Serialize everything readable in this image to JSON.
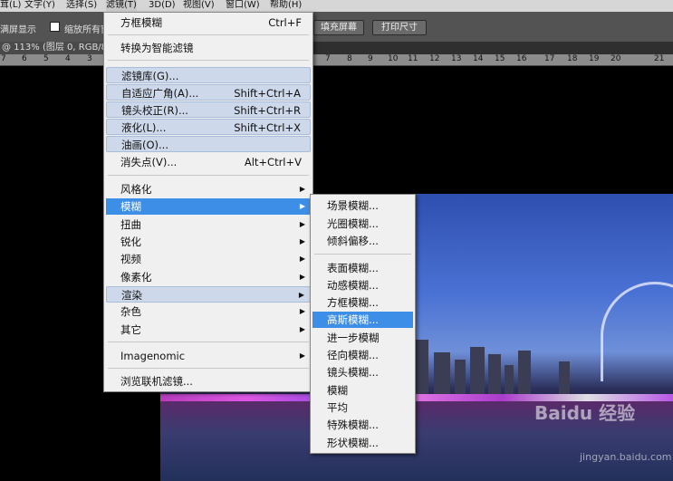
{
  "menubar": {
    "items": [
      "茸(L)",
      "文字(Y)",
      "选择(S)",
      "滤镜(T)",
      "3D(D)",
      "视图(V)",
      "窗口(W)",
      "帮助(H)"
    ]
  },
  "options": {
    "fit_screen_label": "满屏显示",
    "zoom_all_label": "缩放所有窗",
    "fill_screen_button": "填充屏幕",
    "print_size_button": "打印尺寸"
  },
  "document_tab": {
    "label": "@ 113% (图层 0, RGB/8) *"
  },
  "ruler": {
    "ticks": [
      "7",
      "6",
      "5",
      "4",
      "3",
      "7",
      "8",
      "9",
      "10",
      "11",
      "12",
      "13",
      "14",
      "15",
      "16",
      "17",
      "18",
      "19",
      "20",
      "21"
    ]
  },
  "filter_menu": {
    "last_filter": {
      "label": "方框模糊",
      "shortcut": "Ctrl+F"
    },
    "convert_smart": "转换为智能滤镜",
    "filter_gallery": "滤镜库(G)...",
    "adaptive_wide": {
      "label": "自适应广角(A)...",
      "shortcut": "Shift+Ctrl+A"
    },
    "lens_correction": {
      "label": "镜头校正(R)...",
      "shortcut": "Shift+Ctrl+R"
    },
    "liquify": {
      "label": "液化(L)...",
      "shortcut": "Shift+Ctrl+X"
    },
    "oil_paint": "油画(O)...",
    "vanishing_point": {
      "label": "消失点(V)...",
      "shortcut": "Alt+Ctrl+V"
    },
    "stylize": "风格化",
    "blur": "模糊",
    "distort": "扭曲",
    "sharpen": "锐化",
    "video": "视频",
    "pixelate": "像素化",
    "render": "渲染",
    "noise": "杂色",
    "other": "其它",
    "imagenomic": "Imagenomic",
    "browse_online": "浏览联机滤镜..."
  },
  "blur_submenu": {
    "items_group1": [
      "场景模糊...",
      "光圈模糊...",
      "倾斜偏移..."
    ],
    "items_group2": [
      "表面模糊...",
      "动感模糊...",
      "方框模糊...",
      "高斯模糊...",
      "进一步模糊",
      "径向模糊...",
      "镜头模糊...",
      "模糊",
      "平均",
      "特殊模糊...",
      "形状模糊..."
    ]
  },
  "watermark": {
    "brand": "Baidu 经验",
    "url": "jingyan.baidu.com"
  },
  "colors": {
    "menu_highlight": "#3d8ee6",
    "menu_bg": "#f0f0f0",
    "workspace": "#000000",
    "options_bar": "#535353"
  }
}
